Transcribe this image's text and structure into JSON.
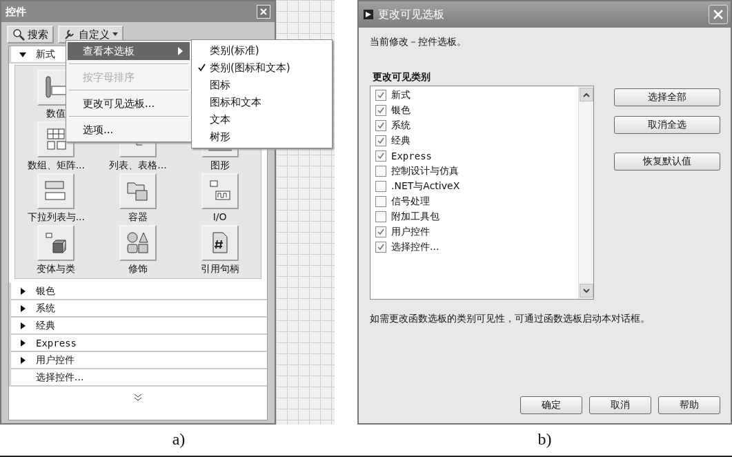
{
  "figure_a": {
    "palette": {
      "title": "控件",
      "toolbar": [
        {
          "label": "搜索",
          "kind": "search"
        },
        {
          "label": "自定义",
          "kind": "customize"
        }
      ],
      "sections": [
        {
          "kind": "category",
          "label": "新式",
          "expanded": true,
          "items": [
            {
              "label": "数值"
            },
            {
              "label": "数组、矩阵..."
            },
            {
              "label": "列表、表格..."
            },
            {
              "label": "图形"
            },
            {
              "label": "下拉列表与..."
            },
            {
              "label": "容器"
            },
            {
              "label": "I/O"
            },
            {
              "label": "变体与类"
            },
            {
              "label": "修饰"
            },
            {
              "label": "引用句柄"
            }
          ]
        },
        {
          "kind": "category",
          "label": "银色",
          "expanded": false
        },
        {
          "kind": "category",
          "label": "系统",
          "expanded": false
        },
        {
          "kind": "category",
          "label": "经典",
          "expanded": false
        },
        {
          "kind": "category",
          "label": "Express",
          "expanded": false
        },
        {
          "kind": "category",
          "label": "用户控件",
          "expanded": false
        },
        {
          "kind": "action",
          "label": "选择控件..."
        }
      ]
    },
    "menu": {
      "items": [
        {
          "label": "查看本选板",
          "selected": true,
          "disabled": false,
          "submenu": true
        },
        {
          "label": "按字母排序",
          "selected": false,
          "disabled": true,
          "submenu": false
        },
        {
          "label": "更改可见选板...",
          "selected": false,
          "disabled": false,
          "submenu": false
        },
        {
          "label": "选项...",
          "selected": false,
          "disabled": false,
          "submenu": false
        }
      ]
    },
    "submenu": {
      "items": [
        {
          "label": "类别(标准)",
          "checked": false
        },
        {
          "label": "类别(图标和文本)",
          "checked": true
        },
        {
          "label": "图标",
          "checked": false
        },
        {
          "label": "图标和文本",
          "checked": false
        },
        {
          "label": "文本",
          "checked": false
        },
        {
          "label": "树形",
          "checked": false
        }
      ]
    },
    "caption": "a)"
  },
  "figure_b": {
    "dialog": {
      "title": "更改可见选板",
      "intro": "当前修改－控件选板。",
      "list_title": "更改可见类别",
      "categories": [
        {
          "label": "新式",
          "checked": true
        },
        {
          "label": "银色",
          "checked": true
        },
        {
          "label": "系统",
          "checked": true
        },
        {
          "label": "经典",
          "checked": true
        },
        {
          "label": "Express",
          "checked": true
        },
        {
          "label": "控制设计与仿真",
          "checked": false
        },
        {
          "label": ".NET与ActiveX",
          "checked": false
        },
        {
          "label": "信号处理",
          "checked": false
        },
        {
          "label": "附加工具包",
          "checked": false
        },
        {
          "label": "用户控件",
          "checked": true
        },
        {
          "label": "选择控件...",
          "checked": true
        }
      ],
      "side_buttons": [
        "选择全部",
        "取消全选",
        "恢复默认值"
      ],
      "note": "如需更改函数选板的类别可见性，可通过函数选板启动本对话框。",
      "buttons": [
        "确定",
        "取消",
        "帮助"
      ]
    },
    "caption": "b)"
  }
}
